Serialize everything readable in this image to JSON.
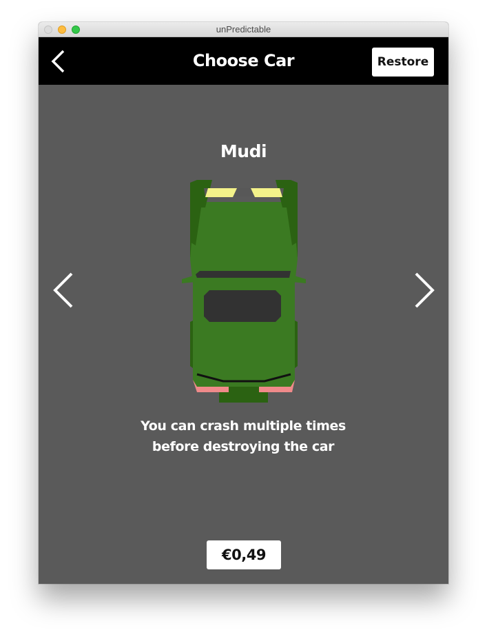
{
  "window": {
    "title": "unPredictable"
  },
  "navbar": {
    "back_icon": "chevron-left-icon",
    "title": "Choose Car",
    "restore_label": "Restore"
  },
  "car": {
    "name": "Mudi",
    "description_line1": "You can crash multiple times",
    "description_line2": "before destroying the car",
    "price_label": "€0,49",
    "prev_icon": "chevron-left-icon",
    "next_icon": "chevron-right-icon"
  },
  "colors": {
    "navbar_bg": "#000000",
    "content_bg": "#5a5a5a",
    "car_body": "#3b7a22",
    "car_dark": "#2b6212",
    "headlights": "#f4f28a",
    "taillights": "#f08a8a",
    "windows": "#323232"
  }
}
